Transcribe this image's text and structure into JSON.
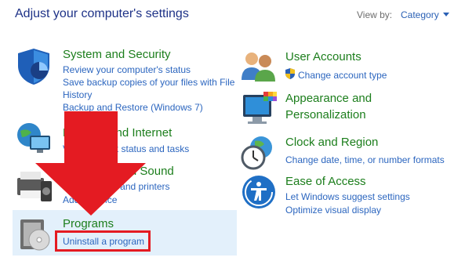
{
  "header": {
    "title": "Adjust your computer's settings",
    "view_by_label": "View by:",
    "view_by_value": "Category"
  },
  "left": {
    "system_security": {
      "title": "System and Security",
      "links": [
        "Review your computer's status",
        "Save backup copies of your files with File",
        "History",
        "Backup and Restore (Windows 7)"
      ]
    },
    "network_internet": {
      "title": "Network and Internet",
      "links": [
        "View network status and tasks"
      ]
    },
    "hardware_sound": {
      "title": "Hardware and Sound",
      "links": [
        "View devices and printers",
        "Add a device"
      ]
    },
    "programs": {
      "title": "Programs",
      "links": [
        "Uninstall a program"
      ]
    }
  },
  "right": {
    "user_accounts": {
      "title": "User Accounts",
      "links": [
        "Change account type"
      ]
    },
    "appearance": {
      "title_line1": "Appearance and",
      "title_line2": "Personalization"
    },
    "clock_region": {
      "title": "Clock and Region",
      "links": [
        "Change date, time, or number formats"
      ]
    },
    "ease_access": {
      "title": "Ease of Access",
      "links": [
        "Let Windows suggest settings",
        "Optimize visual display"
      ]
    }
  },
  "colors": {
    "category_title": "#1c7e1c",
    "link": "#2c66bf",
    "highlight": "#e3f0fb",
    "annotation_red": "#e41b22"
  },
  "icons": {
    "system_security": "shield-icon",
    "network_internet": "network-globe-icon",
    "hardware_sound": "printer-speaker-icon",
    "programs": "programs-disc-icon",
    "user_accounts": "users-icon",
    "appearance": "monitor-colors-icon",
    "clock_region": "clock-globe-icon",
    "ease_access": "ease-of-access-icon",
    "uac_shield": "uac-shield-icon",
    "annotation": "red-arrow-annotation"
  }
}
